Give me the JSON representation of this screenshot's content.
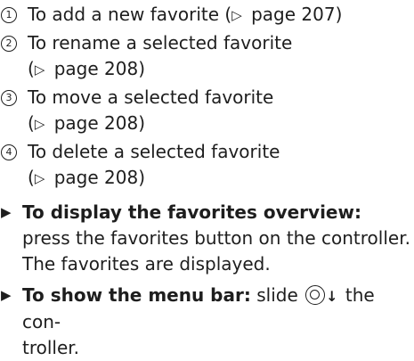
{
  "items": [
    {
      "num": "1",
      "text": "To add a new favorite (",
      "ref_tri": "▷",
      "ref_page": " page 207)"
    },
    {
      "num": "2",
      "text": "To rename a selected favorite",
      "ref_pre": "(",
      "ref_tri": "▷",
      "ref_page": " page 208)"
    },
    {
      "num": "3",
      "text": "To move a selected favorite",
      "ref_pre": "(",
      "ref_tri": "▷",
      "ref_page": " page 208)"
    },
    {
      "num": "4",
      "text": "To delete a selected favorite",
      "ref_pre": "(",
      "ref_tri": "▷",
      "ref_page": " page 208)"
    }
  ],
  "steps": [
    {
      "bullet": "▶",
      "bold": "To display the favorites overview:",
      "text": " press the favorites button on the controller.",
      "result": "The favorites are displayed."
    },
    {
      "bullet": "▶",
      "bold": "To show the menu bar:",
      "text_pre": " slide ",
      "icon": "controller-slide-down-icon",
      "arrow": "↓",
      "text_post": " the con-",
      "text_line2": "troller."
    }
  ]
}
